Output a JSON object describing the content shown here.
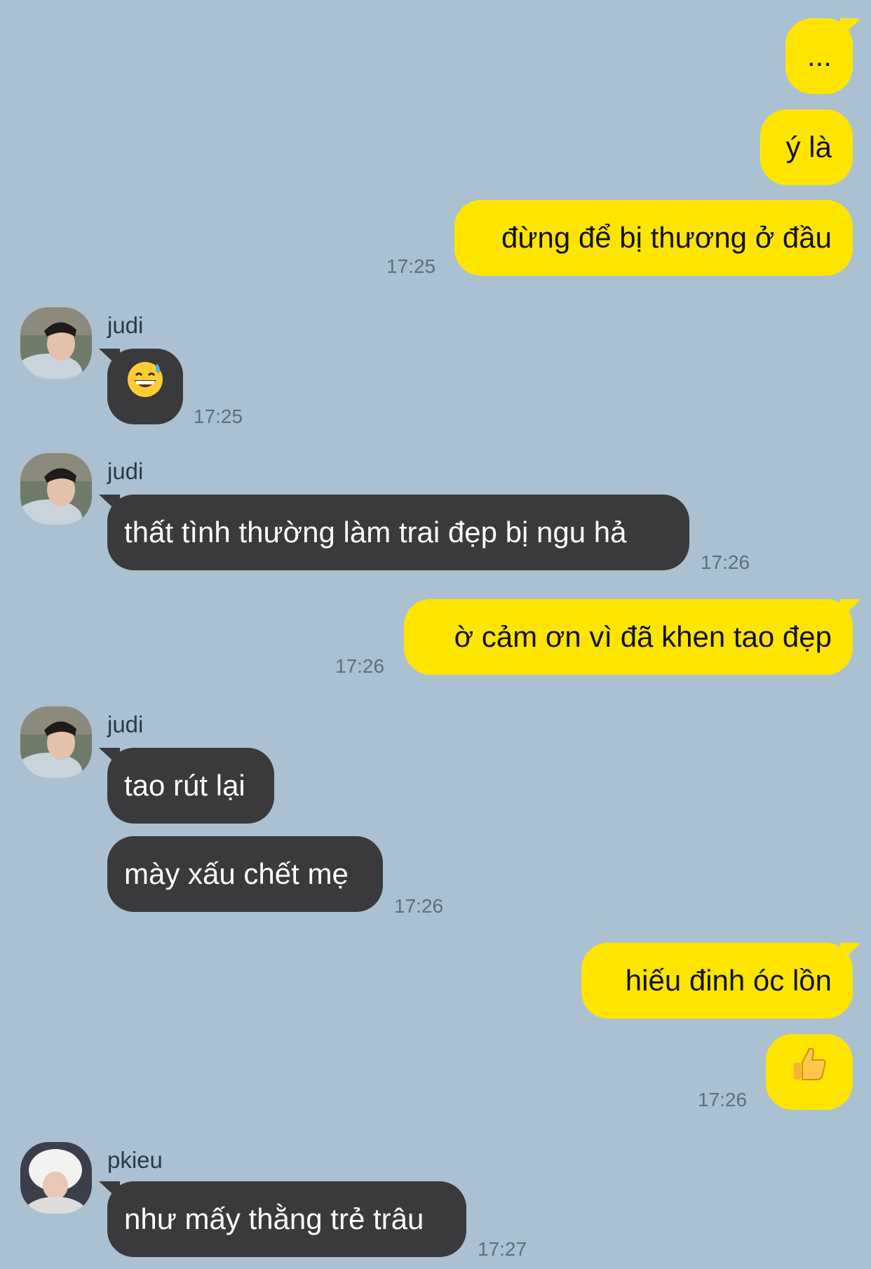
{
  "colors": {
    "background": "#abc1d1",
    "my_bubble": "#fee500",
    "their_bubble": "#3a3a3c",
    "timestamp": "#5f6f7c"
  },
  "messages": [
    {
      "side": "me",
      "text": "..."
    },
    {
      "side": "me",
      "text": "ý là"
    },
    {
      "side": "me",
      "text": "đừng để bị thương ở đầu",
      "time": "17:25"
    },
    {
      "side": "them",
      "sender": "judi",
      "emoji": "grinning-sweat-emoji",
      "time": "17:25"
    },
    {
      "side": "them",
      "sender": "judi",
      "text": "thất tình thường làm trai đẹp bị ngu hả",
      "time": "17:26"
    },
    {
      "side": "me",
      "text": "ờ cảm ơn vì đã khen tao đẹp",
      "time": "17:26"
    },
    {
      "side": "them",
      "sender": "judi",
      "text": "tao rút lại"
    },
    {
      "side": "them",
      "text": "mày xấu chết mẹ",
      "time": "17:26"
    },
    {
      "side": "me",
      "text": "hiếu đinh óc lồn"
    },
    {
      "side": "me",
      "emoji": "thumbs-up-emoji",
      "time": "17:26"
    },
    {
      "side": "them",
      "sender": "pkieu",
      "text": "như mấy thằng trẻ trâu",
      "time": "17:27"
    }
  ]
}
